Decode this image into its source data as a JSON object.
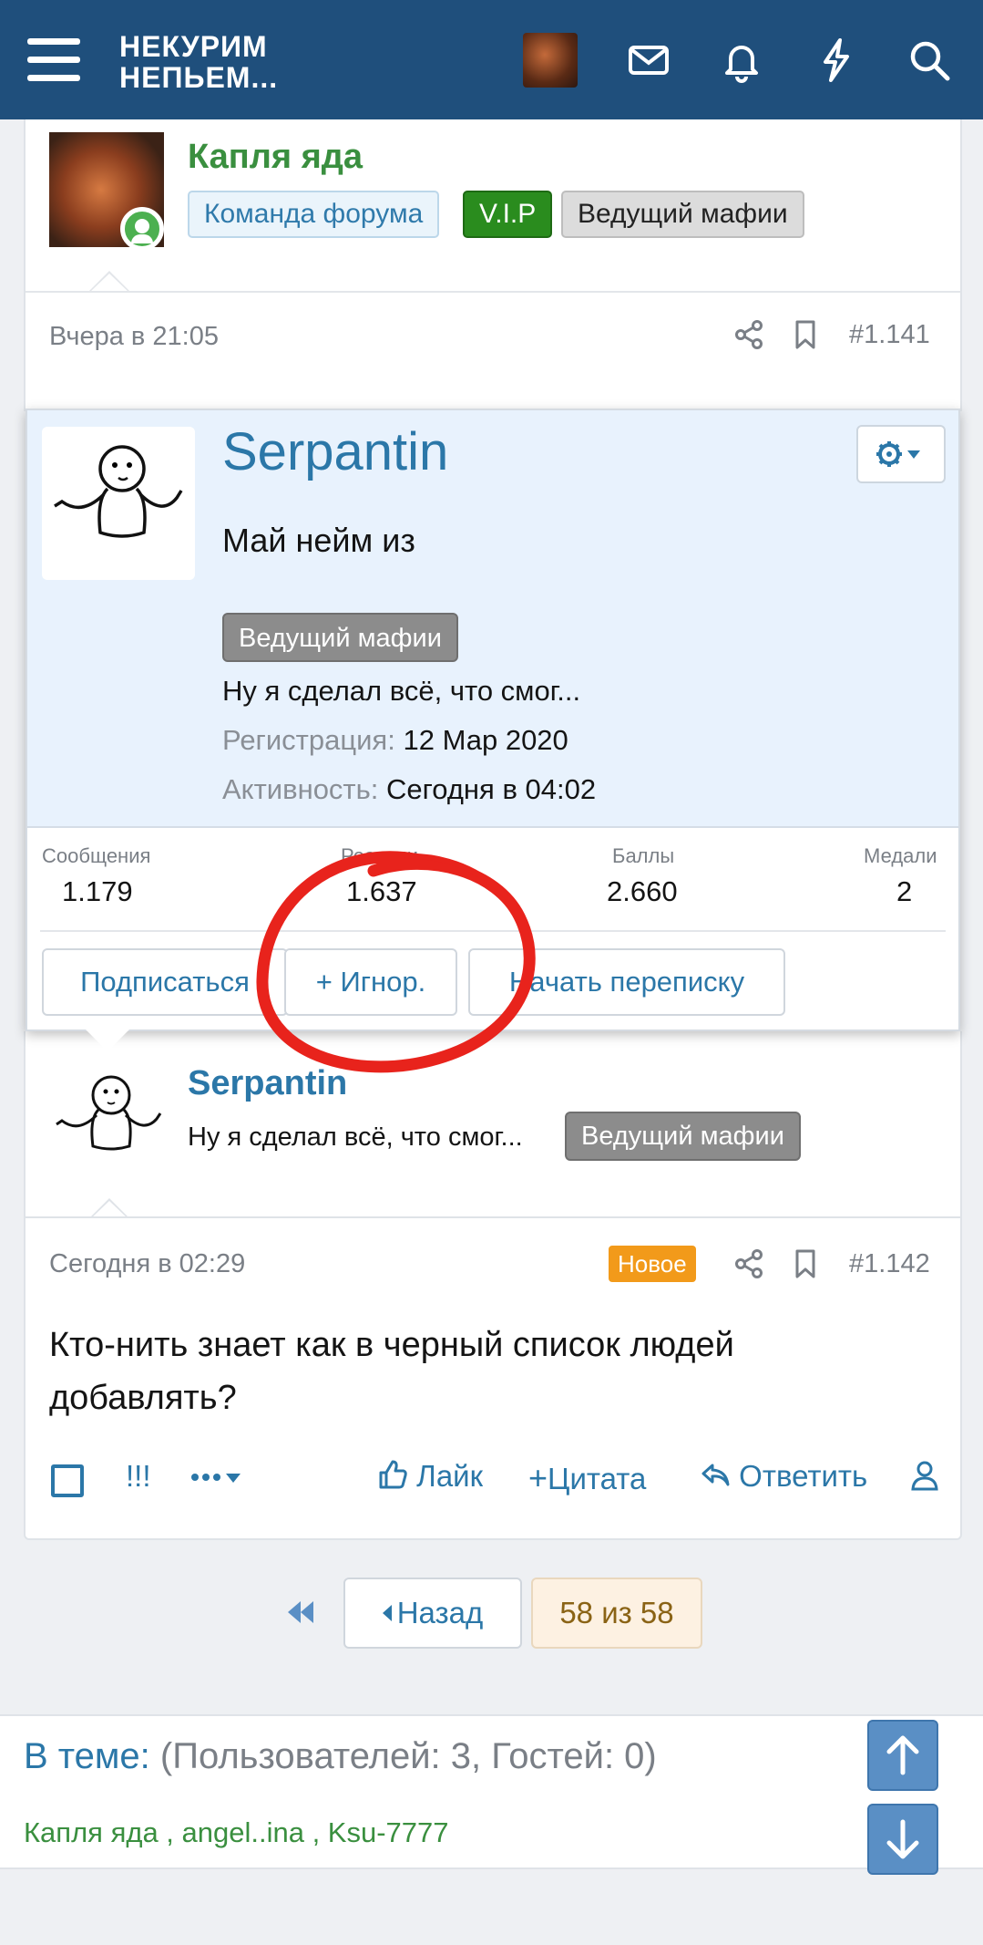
{
  "header": {
    "logo_line1": "НЕКУРИМ",
    "logo_line2": "НЕПЬЕМ...",
    "icons": [
      "menu-icon",
      "avatar",
      "mail-icon",
      "bell-icon",
      "bolt-icon",
      "search-icon"
    ],
    "bg_color": "#1f4f7c"
  },
  "post1": {
    "author": "Капля яда",
    "banners": [
      "Команда форума",
      "V.I.P",
      "Ведущий мафии"
    ],
    "time": "Вчера в 21:05",
    "number": "#1.141"
  },
  "member_popup": {
    "name": "Serpantin",
    "title": "Май нейм из",
    "badge": "Ведущий мафии",
    "status": "Ну я сделал всё, что смог...",
    "reg_label": "Регистрация:",
    "reg_value": "12 Мар 2020",
    "act_label": "Активность:",
    "act_value": "Сегодня в 04:02",
    "stats": {
      "messages_label": "Сообщения",
      "messages": "1.179",
      "reactions_label": "Реакции",
      "reactions": "1.637",
      "points_label": "Баллы",
      "points": "2.660",
      "medals_label": "Медали",
      "medals": "2"
    },
    "buttons": {
      "follow": "Подписаться",
      "ignore": "+ Игнор.",
      "message": "Начать переписку"
    }
  },
  "post2": {
    "author": "Serpantin",
    "status": "Ну я сделал всё, что смог...",
    "badge": "Ведущий мафии"
  },
  "post3": {
    "time": "Сегодня в 02:29",
    "new_badge": "Новое",
    "number": "#1.142",
    "text": "Кто-нить знает как в черный список людей добавлять?",
    "actions": {
      "report": "!!!",
      "like": "Лайк",
      "quote": "Цитата",
      "reply": "Ответить"
    }
  },
  "pager": {
    "back": "Назад",
    "current": "58 из 58"
  },
  "footer": {
    "title_blue": "В теме:",
    "title_grey": "(Пользователей: 3, Гостей: 0)",
    "users": "Капля яда , angel..ina , Ksu-7777"
  },
  "colors": {
    "link_blue": "#2b77a8",
    "green": "#3a8f3f",
    "annotation_red": "#e8231c"
  }
}
